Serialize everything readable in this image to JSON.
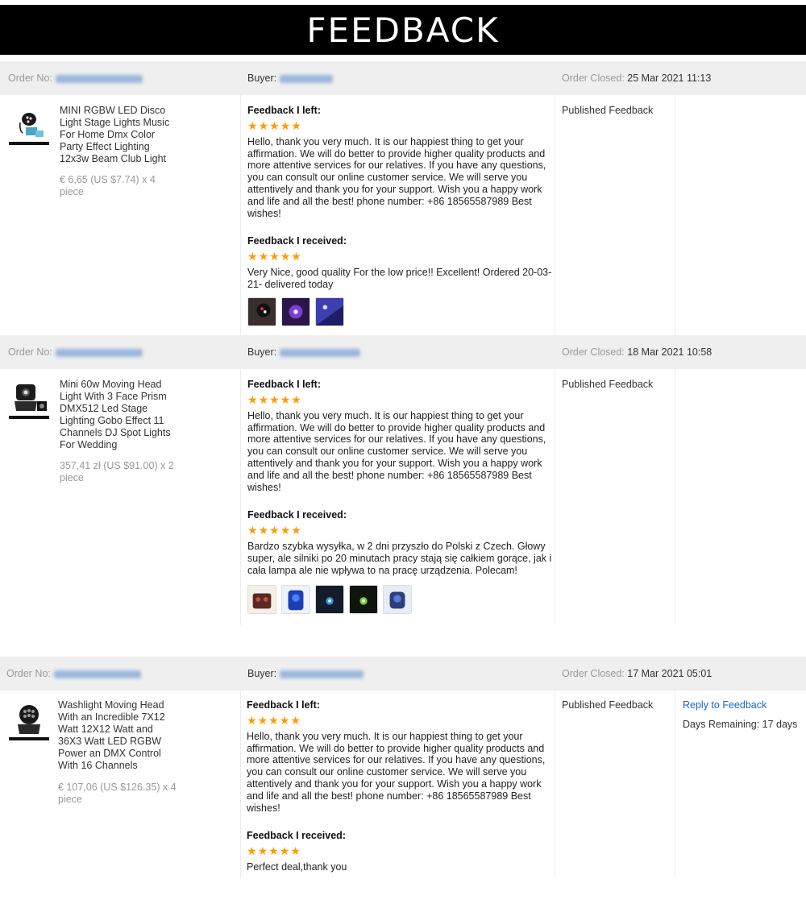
{
  "banner": {
    "title": "FEEDBACK"
  },
  "labels": {
    "order_no": "Order No:",
    "buyer": "Buyer:",
    "order_closed": "Order Closed:",
    "feedback_left": "Feedback I left:",
    "feedback_received": "Feedback I received:",
    "published": "Published Feedback"
  },
  "colors": {
    "star": "#ff9b00",
    "link": "#1a66cc",
    "header_bg": "#efefef",
    "banner_bg": "#000000"
  },
  "orders": [
    {
      "closed_date": "25 Mar 2021 11:13",
      "product_title": "MINI RGBW LED Disco Light Stage Lights Music For Home Dmx Color Party Effect Lighting 12x3w Beam Club Light",
      "price": "€ 6,65 (US $7.74) x 4 piece",
      "left_rating": 5,
      "left_text": "Hello, thank you very much. It is our happiest thing to get your affirmation. We will do better to provide higher quality products and more attentive services for our relatives. If you have any questions, you can consult our online customer service. We will serve you attentively and thank you for your support. Wish you a happy work and life and all the best! phone number: +86 18565587989 Best wishes!",
      "received_rating": 5,
      "received_text": "Very Nice, good quality For the low price!! Excellent! Ordered 20-03-21- delivered today",
      "photo_count": 3
    },
    {
      "closed_date": "18 Mar 2021 10:58",
      "product_title": "Mini 60w Moving Head Light With 3 Face Prism DMX512 Led Stage Lighting Gobo Effect 11 Channels DJ Spot Lights For Wedding",
      "price": "357,41 zł (US $91.00) x 2 piece",
      "left_rating": 5,
      "left_text": "Hello, thank you very much. It is our happiest thing to get your affirmation. We will do better to provide higher quality products and more attentive services for our relatives. If you have any questions, you can consult our online customer service. We will serve you attentively and thank you for your support. Wish you a happy work and life and all the best! phone number: +86 18565587989 Best wishes!",
      "received_rating": 5,
      "received_text": "Bardzo szybka wysyłka, w 2 dni przyszło do Polski z Czech. Głowy super, ale silniki po 20 minutach pracy stają się całkiem gorące, jak i cała lampa ale nie wpływa to na pracę urządzenia. Polecam!",
      "photo_count": 5
    },
    {
      "closed_date": "17 Mar 2021 05:01",
      "product_title": "Washlight Moving Head With an Incredible 7X12 Watt 12X12 Watt and 36X3 Watt LED RGBW Power an DMX Control With 16 Channels",
      "price": "€ 107,06 (US $126.35) x 4 piece",
      "left_rating": 5,
      "left_text": "Hello, thank you very much. It is our happiest thing to get your affirmation. We will do better to provide higher quality products and more attentive services for our relatives. If you have any questions, you can consult our online customer service. We will serve you attentively and thank you for your support. Wish you a happy work and life and all the best! phone number: +86 18565587989 Best wishes!",
      "received_rating": 5,
      "received_text": "Perfect deal,thank you",
      "photo_count": 0,
      "reply_link": "Reply to Feedback",
      "days_remaining": "Days Remaining: 17 days"
    }
  ]
}
